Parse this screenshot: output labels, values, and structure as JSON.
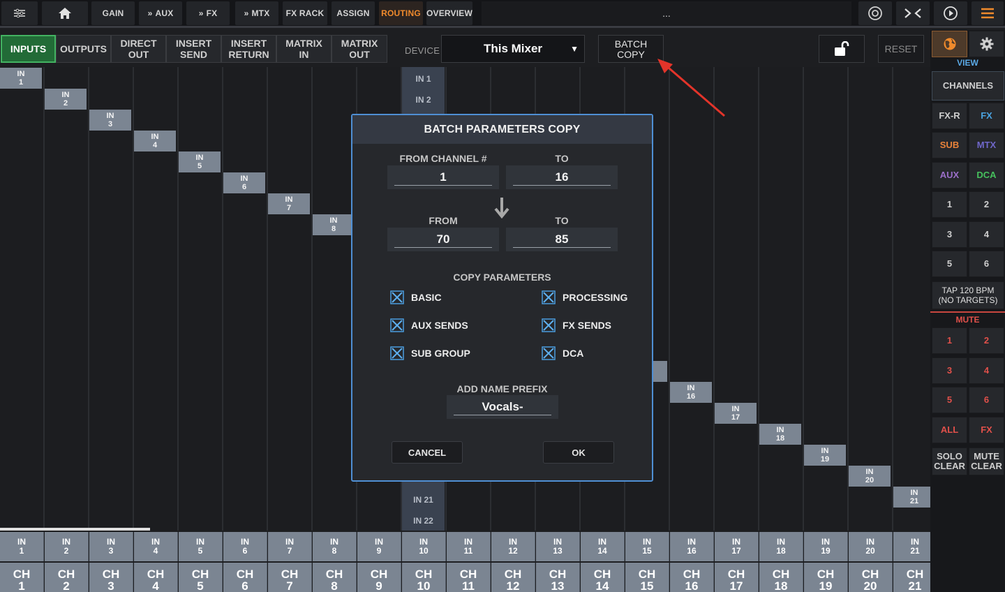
{
  "topbar": {
    "gain": "GAIN",
    "aux": "AUX",
    "fx": "FX",
    "mtx": "MTX",
    "fx_rack": "FX RACK",
    "assign": "ASSIGN",
    "routing": "ROUTING",
    "overview": "OVERVIEW",
    "title": "...",
    "accent_color": "#f08a2c"
  },
  "tabs": [
    {
      "l1": "INPUTS",
      "l2": ""
    },
    {
      "l1": "OUTPUTS",
      "l2": ""
    },
    {
      "l1": "DIRECT",
      "l2": "OUT"
    },
    {
      "l1": "INSERT",
      "l2": "SEND"
    },
    {
      "l1": "INSERT",
      "l2": "RETURN"
    },
    {
      "l1": "MATRIX",
      "l2": "IN"
    },
    {
      "l1": "MATRIX",
      "l2": "OUT"
    }
  ],
  "device": {
    "label": "DEVICE",
    "value": "This Mixer"
  },
  "batch_copy": {
    "l1": "BATCH",
    "l2": "COPY"
  },
  "reset": "RESET",
  "grid": {
    "diagonal_visible": [
      {
        "l1": "IN",
        "l2": "1"
      },
      {
        "l1": "IN",
        "l2": "2"
      },
      {
        "l1": "IN",
        "l2": "3"
      },
      {
        "l1": "IN",
        "l2": "4"
      },
      {
        "l1": "IN",
        "l2": "5"
      },
      {
        "l1": "IN",
        "l2": "6"
      },
      {
        "l1": "IN",
        "l2": "7"
      },
      {
        "l1": "IN",
        "l2": "8"
      },
      {
        "l1": "IN",
        "l2": "16"
      },
      {
        "l1": "IN",
        "l2": "17"
      },
      {
        "l1": "IN",
        "l2": "18"
      },
      {
        "l1": "IN",
        "l2": "19"
      },
      {
        "l1": "IN",
        "l2": "20"
      },
      {
        "l1": "IN",
        "l2": "21"
      }
    ],
    "mid_labels": [
      "IN 1",
      "IN 2",
      "IN 21",
      "IN 22"
    ]
  },
  "bottom": {
    "inputs": [
      "1",
      "2",
      "3",
      "4",
      "5",
      "6",
      "7",
      "8",
      "9",
      "10",
      "11",
      "12",
      "13",
      "14",
      "15",
      "16",
      "17",
      "18",
      "19",
      "20",
      "21"
    ],
    "in_prefix": "IN",
    "ch_prefix": "CH"
  },
  "sidebar": {
    "view": "VIEW",
    "channels": "CHANNELS",
    "fxr": "FX-R",
    "fx": "FX",
    "sub": "SUB",
    "mtx": "MTX",
    "aux": "AUX",
    "dca": "DCA",
    "banks": [
      "1",
      "2",
      "3",
      "4",
      "5",
      "6"
    ],
    "tap_l1": "TAP 120 BPM",
    "tap_l2": "(NO TARGETS)",
    "mute": "MUTE",
    "mute_groups": [
      "1",
      "2",
      "3",
      "4",
      "5",
      "6"
    ],
    "all": "ALL",
    "mute_fx": "FX",
    "solo_l1": "SOLO",
    "solo_l2": "CLEAR",
    "mutec_l1": "MUTE",
    "mutec_l2": "CLEAR",
    "colors": {
      "fx": "#4aa3e0",
      "sub": "#e8823a",
      "mtx": "#6f67c9",
      "aux": "#9b6fc9",
      "dca": "#46c05d",
      "mute": "#e0504a"
    }
  },
  "modal": {
    "title": "BATCH PARAMETERS COPY",
    "from_channel_label": "FROM CHANNEL #",
    "to_label": "TO",
    "from_channel": "1",
    "to_channel": "16",
    "from_label": "FROM",
    "to_label2": "TO",
    "from_value": "70",
    "to_value": "85",
    "copy_params_label": "COPY PARAMETERS",
    "params": [
      "BASIC",
      "PROCESSING",
      "AUX SENDS",
      "FX SENDS",
      "SUB GROUP",
      "DCA"
    ],
    "prefix_label": "ADD NAME PREFIX",
    "prefix_value": "Vocals-",
    "cancel": "CANCEL",
    "ok": "OK",
    "border_color": "#4f8fd4"
  }
}
